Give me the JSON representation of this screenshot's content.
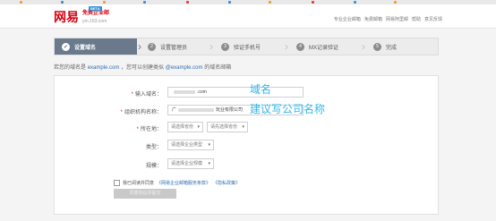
{
  "brand": {
    "logo_text": "网易",
    "product": "免费企业邮",
    "badge": "BETA",
    "domain": "ym.163.com"
  },
  "top_nav": [
    "专业企业邮箱",
    "免费邮箱",
    "网易阿里邮",
    "帮助",
    "意见反馈"
  ],
  "steps": [
    {
      "label": "设置域名",
      "active": true
    },
    {
      "label": "设置管理员",
      "active": false
    },
    {
      "label": "验证手机号",
      "active": false
    },
    {
      "label": "MX记录验证",
      "active": false
    },
    {
      "label": "完成",
      "active": false
    }
  ],
  "domain_hint": {
    "prefix": "若您的域名是",
    "example_domain": "example.com",
    "middle": "，您可以创建类似",
    "example_email": "@example.com",
    "suffix": "的域名邮箱"
  },
  "form": {
    "domain_label": "输入域名：",
    "domain_value": ".com",
    "org_label": "组织机构名称：",
    "org_value_prefix": "广",
    "org_value_suffix": "玩业有限公司",
    "location_label": "所在地：",
    "province_placeholder": "请选择省份",
    "city_placeholder": "请先选择省份",
    "type_label": "类型：",
    "type_placeholder": "请选择企业类型",
    "scale_label": "规模：",
    "scale_placeholder": "请选择企业规模",
    "agree_prefix": "我已阅读并同意",
    "agree_link1": "《网易企业邮箱服务条款》",
    "agree_link2": "《隐私政策》",
    "submit_label": "同意协议并提交"
  },
  "annotations": {
    "domain": "域名",
    "company": "建议写公司名称"
  }
}
